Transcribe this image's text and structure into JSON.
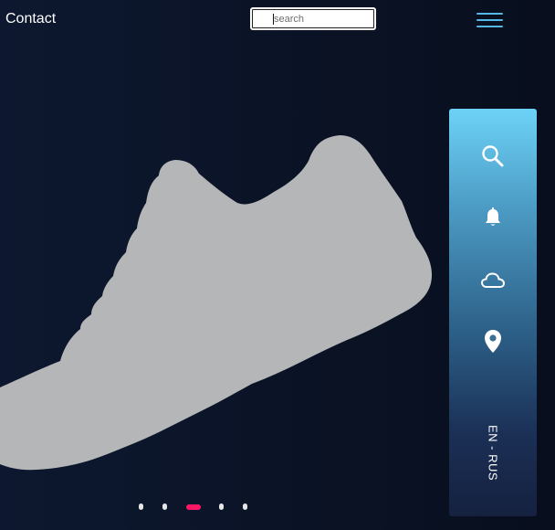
{
  "header": {
    "contact_label": "Contact",
    "search": {
      "placeholder": "search",
      "value": ""
    },
    "menu_icon": "hamburger-menu-icon"
  },
  "hero": {
    "image": "sneaker-silhouette",
    "shoe_color": "#b5b6b8"
  },
  "side_panel": {
    "icons": [
      "search-icon",
      "bell-icon",
      "cloud-icon",
      "location-pin-icon"
    ],
    "language_label": "EN - RUS",
    "gradient_top": "#6dd2f7",
    "gradient_bottom": "#15213f"
  },
  "slider": {
    "total": 5,
    "active_index": 2,
    "active_color": "#ff1766"
  },
  "colors": {
    "background": "#0b1427",
    "accent": "#55b7e6"
  }
}
